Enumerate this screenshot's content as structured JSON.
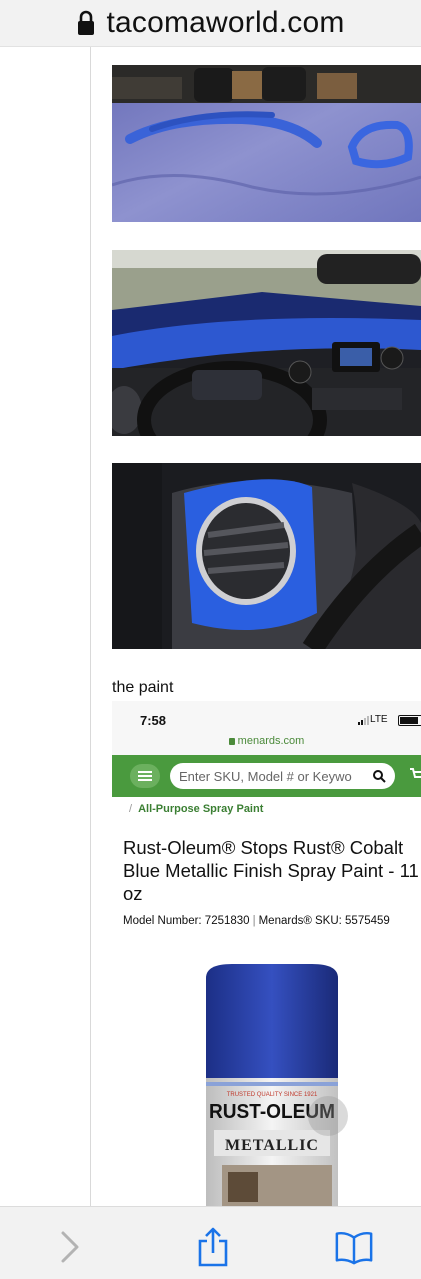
{
  "browser": {
    "domain": "tacomaworld.com",
    "lock_icon": "lock-icon",
    "toolbar": {
      "forward_icon": "chevron-right-icon",
      "share_icon": "share-icon",
      "bookmarks_icon": "book-icon"
    }
  },
  "post": {
    "photos": [
      {
        "subject": "blue painted interior trim pieces on towel"
      },
      {
        "subject": "truck dashboard with blue trim"
      },
      {
        "subject": "blue air vent close-up"
      }
    ],
    "caption": "the paint"
  },
  "embedded_screenshot": {
    "status_time": "7:58",
    "network": "LTE",
    "url": "menards.com",
    "search_placeholder": "Enter SKU, Model # or Keywo",
    "breadcrumb": "All-Purpose Spray Paint",
    "product_title": "Rust-Oleum® Stops Rust® Cobalt Blue Metallic Finish Spray Paint - 11 oz",
    "model_label": "Model Number: 7251830",
    "sku_label": "Menards® SKU: 5575459",
    "can_tagline": "TRUSTED QUALITY SINCE 1921",
    "can_brand": "RUST-OLEUM",
    "can_type": "METALLIC"
  },
  "colors": {
    "menards_green": "#4a9a3e",
    "cobalt_blue": "#2a4fb0",
    "toolbar_blue": "#1a73e8"
  }
}
